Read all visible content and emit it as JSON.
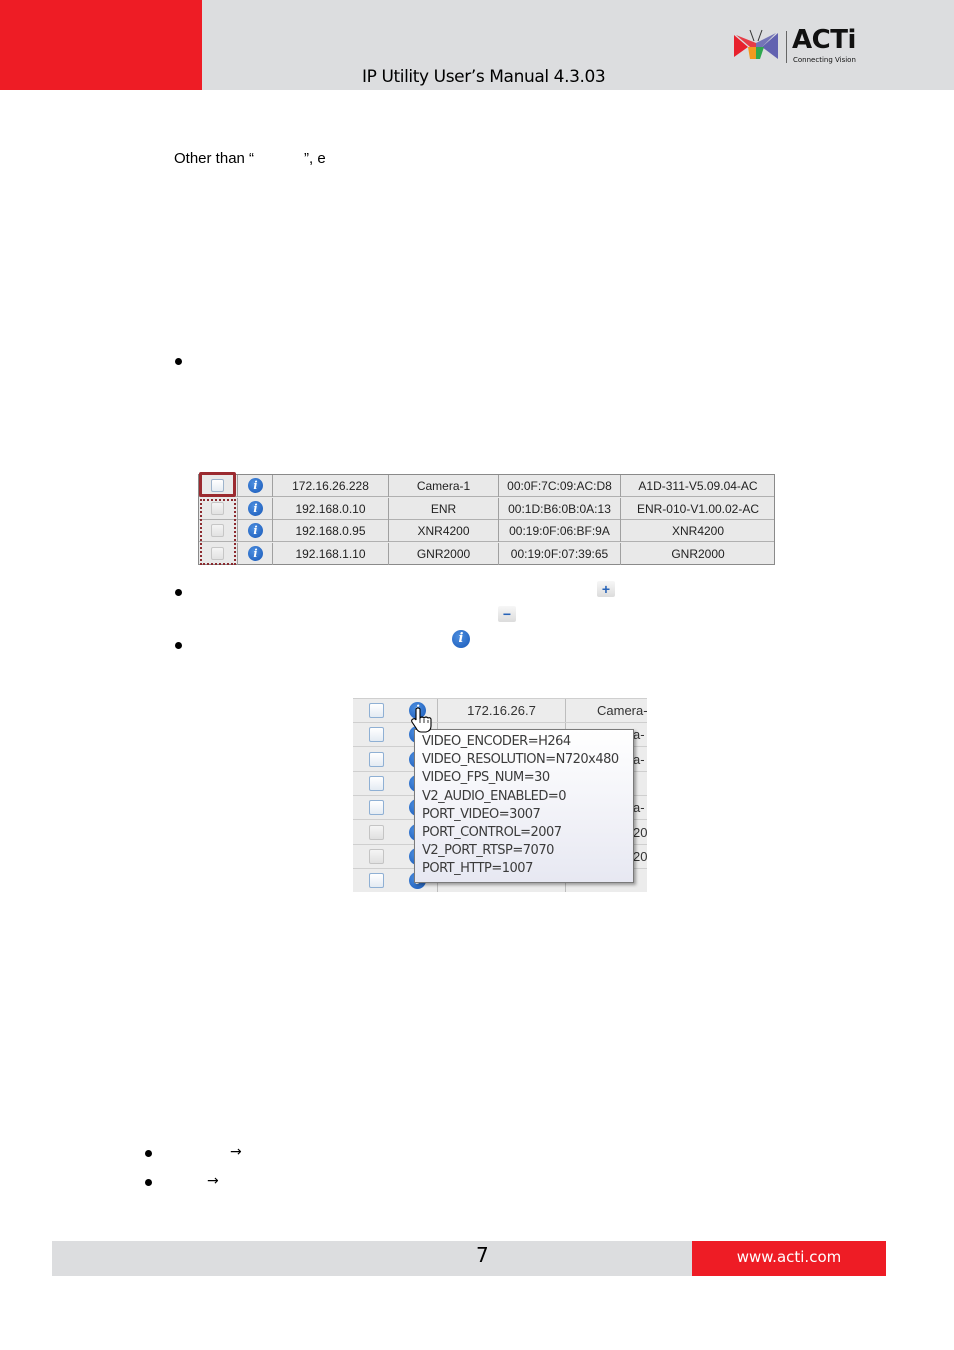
{
  "header": {
    "title": "IP Utility User’s Manual 4.3.03",
    "logo": {
      "brand": "ACTi",
      "tagline": "Connecting Vision"
    },
    "colors": {
      "brand_red": "#ee1c25",
      "band_gray": "#dcdddf"
    }
  },
  "body": {
    "paragraph_fragment": "Other than “            ”, e",
    "device_table": {
      "columns": [
        "select",
        "info",
        "ip",
        "name",
        "mac",
        "version"
      ],
      "rows": [
        {
          "checked": false,
          "highlighted": true,
          "ip": "172.16.26.228",
          "name": "Camera-1",
          "mac": "00:0F:7C:09:AC:D8",
          "version": "A1D-311-V5.09.04-AC"
        },
        {
          "checked": false,
          "highlighted": false,
          "ip": "192.168.0.10",
          "name": "ENR",
          "mac": "00:1D:B6:0B:0A:13",
          "version": "ENR-010-V1.00.02-AC"
        },
        {
          "checked": false,
          "highlighted": false,
          "ip": "192.168.0.95",
          "name": "XNR4200",
          "mac": "00:19:0F:06:BF:9A",
          "version": "XNR4200"
        },
        {
          "checked": false,
          "highlighted": false,
          "ip": "192.168.1.10",
          "name": "GNR2000",
          "mac": "00:19:0F:07:39:65",
          "version": "GNR2000"
        }
      ]
    },
    "inline_icons": {
      "expand": "+",
      "collapse": "−",
      "info": "i"
    },
    "tooltip_screenshot": {
      "first_row_ip": "172.16.26.7",
      "first_row_name": "Camera-",
      "partial_names": [
        "a-",
        "a-",
        "",
        "a-",
        "20",
        "20",
        ""
      ],
      "tooltip_lines": [
        "VIDEO_ENCODER=H264",
        "VIDEO_RESOLUTION=N720x480",
        "VIDEO_FPS_NUM=30",
        "V2_AUDIO_ENABLED=0",
        "PORT_VIDEO=3007",
        "PORT_CONTROL=2007",
        "V2_PORT_RTSP=7070",
        "PORT_HTTP=1007"
      ]
    },
    "arrow_glyph": "→"
  },
  "footer": {
    "page_number": "7",
    "url": "www.acti.com"
  }
}
